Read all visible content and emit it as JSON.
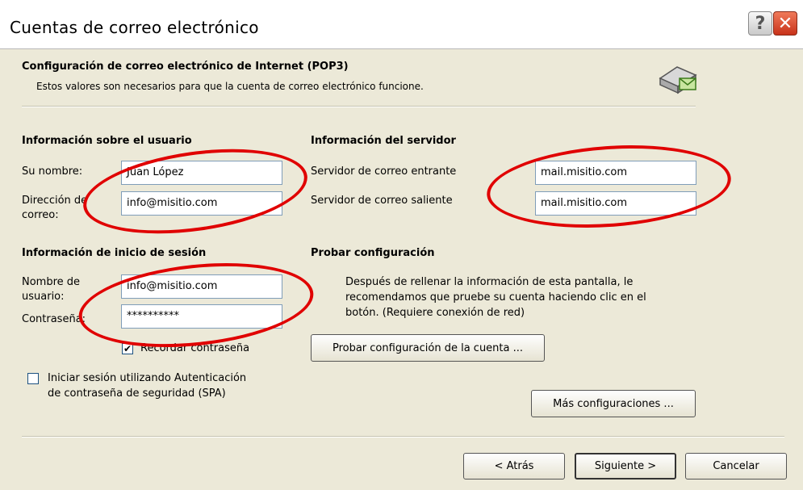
{
  "window": {
    "title": "Cuentas de correo electrónico",
    "help_glyph": "?",
    "close_glyph": "✕"
  },
  "header": {
    "title": "Configuración de correo electrónico de Internet (POP3)",
    "description": "Estos valores son necesarios para que la cuenta de correo electrónico funcione."
  },
  "user_info": {
    "heading": "Información sobre el usuario",
    "name_label": "Su nombre:",
    "name_value": "Juan López",
    "email_label_line1": "Dirección de",
    "email_label_line2": "correo:",
    "email_value": "info@misitio.com"
  },
  "server_info": {
    "heading": "Información del servidor",
    "incoming_label": "Servidor de correo entrante",
    "incoming_value": "mail.misitio.com",
    "outgoing_label": "Servidor de correo saliente",
    "outgoing_value": "mail.misitio.com"
  },
  "login_info": {
    "heading": "Información de inicio de sesión",
    "username_label_line1": "Nombre de",
    "username_label_line2": "usuario:",
    "username_value": "info@misitio.com",
    "password_label": "Contraseña:",
    "password_value": "**********",
    "remember_label": "Recordar contraseña",
    "remember_checked": true,
    "remember_glyph": "✔",
    "spa_label_line1": "Iniciar sesión utilizando Autenticación",
    "spa_label_line2": "de contraseña de seguridad (SPA)",
    "spa_checked": false
  },
  "test_config": {
    "heading": "Probar configuración",
    "text_line1": "Después de rellenar la información de esta pantalla, le",
    "text_line2": "recomendamos que pruebe su cuenta haciendo clic en el",
    "text_line3": "botón. (Requiere conexión de red)",
    "test_button": "Probar configuración de la cuenta ..."
  },
  "more_settings_button": "Más configuraciones ...",
  "footer": {
    "back_button": "< Atrás",
    "next_button": "Siguiente >",
    "cancel_button": "Cancelar"
  },
  "colors": {
    "highlight": "#e00000",
    "dialog_bg": "#ECE9D8"
  }
}
